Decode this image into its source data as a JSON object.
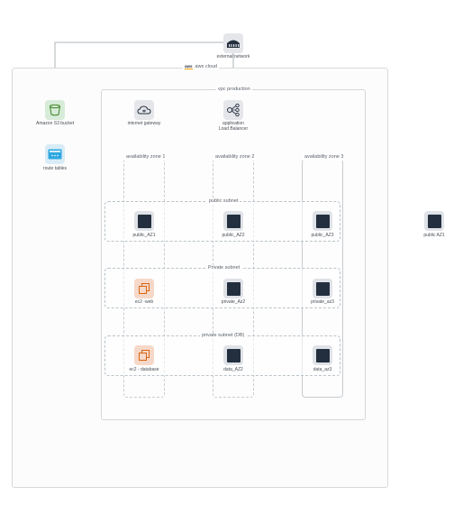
{
  "groups": {
    "aws_cloud": "aws cloud",
    "aws_logo_text": "aws",
    "vpc": "vpc production",
    "az1": "availability zone 1",
    "az2": "availability zone 2",
    "az3": "availability zone 3",
    "public_subnet": "public subnet",
    "private_subnet": "Private subnet",
    "db_subnet": "private subnet (DB)"
  },
  "nodes": {
    "external_network": "external network",
    "s3_bucket": "Amazon S3 bucket",
    "route_tables": "route tables",
    "internet_gateway": "internet gateway",
    "alb_line1": "application",
    "alb_line2": "Load Balancer",
    "public_az1": "public_AZ1",
    "public_az2": "public_AZ2",
    "public_az3": "public_AZ3",
    "public_az1_outside": "public AZ1",
    "ec2_web": "ec2 -web",
    "private_az2": "private_Az2",
    "private_az3": "private_az3",
    "ec2_database": "ec2 - database",
    "data_az2": "data_AZ2",
    "data_az3": "data_az3"
  },
  "colors": {
    "dark_icon": "#232f3e",
    "s3_green": "#3f8624",
    "route_blue": "#2ea7e0",
    "ec2_orange": "#d86613",
    "aws_orange": "#f90"
  }
}
